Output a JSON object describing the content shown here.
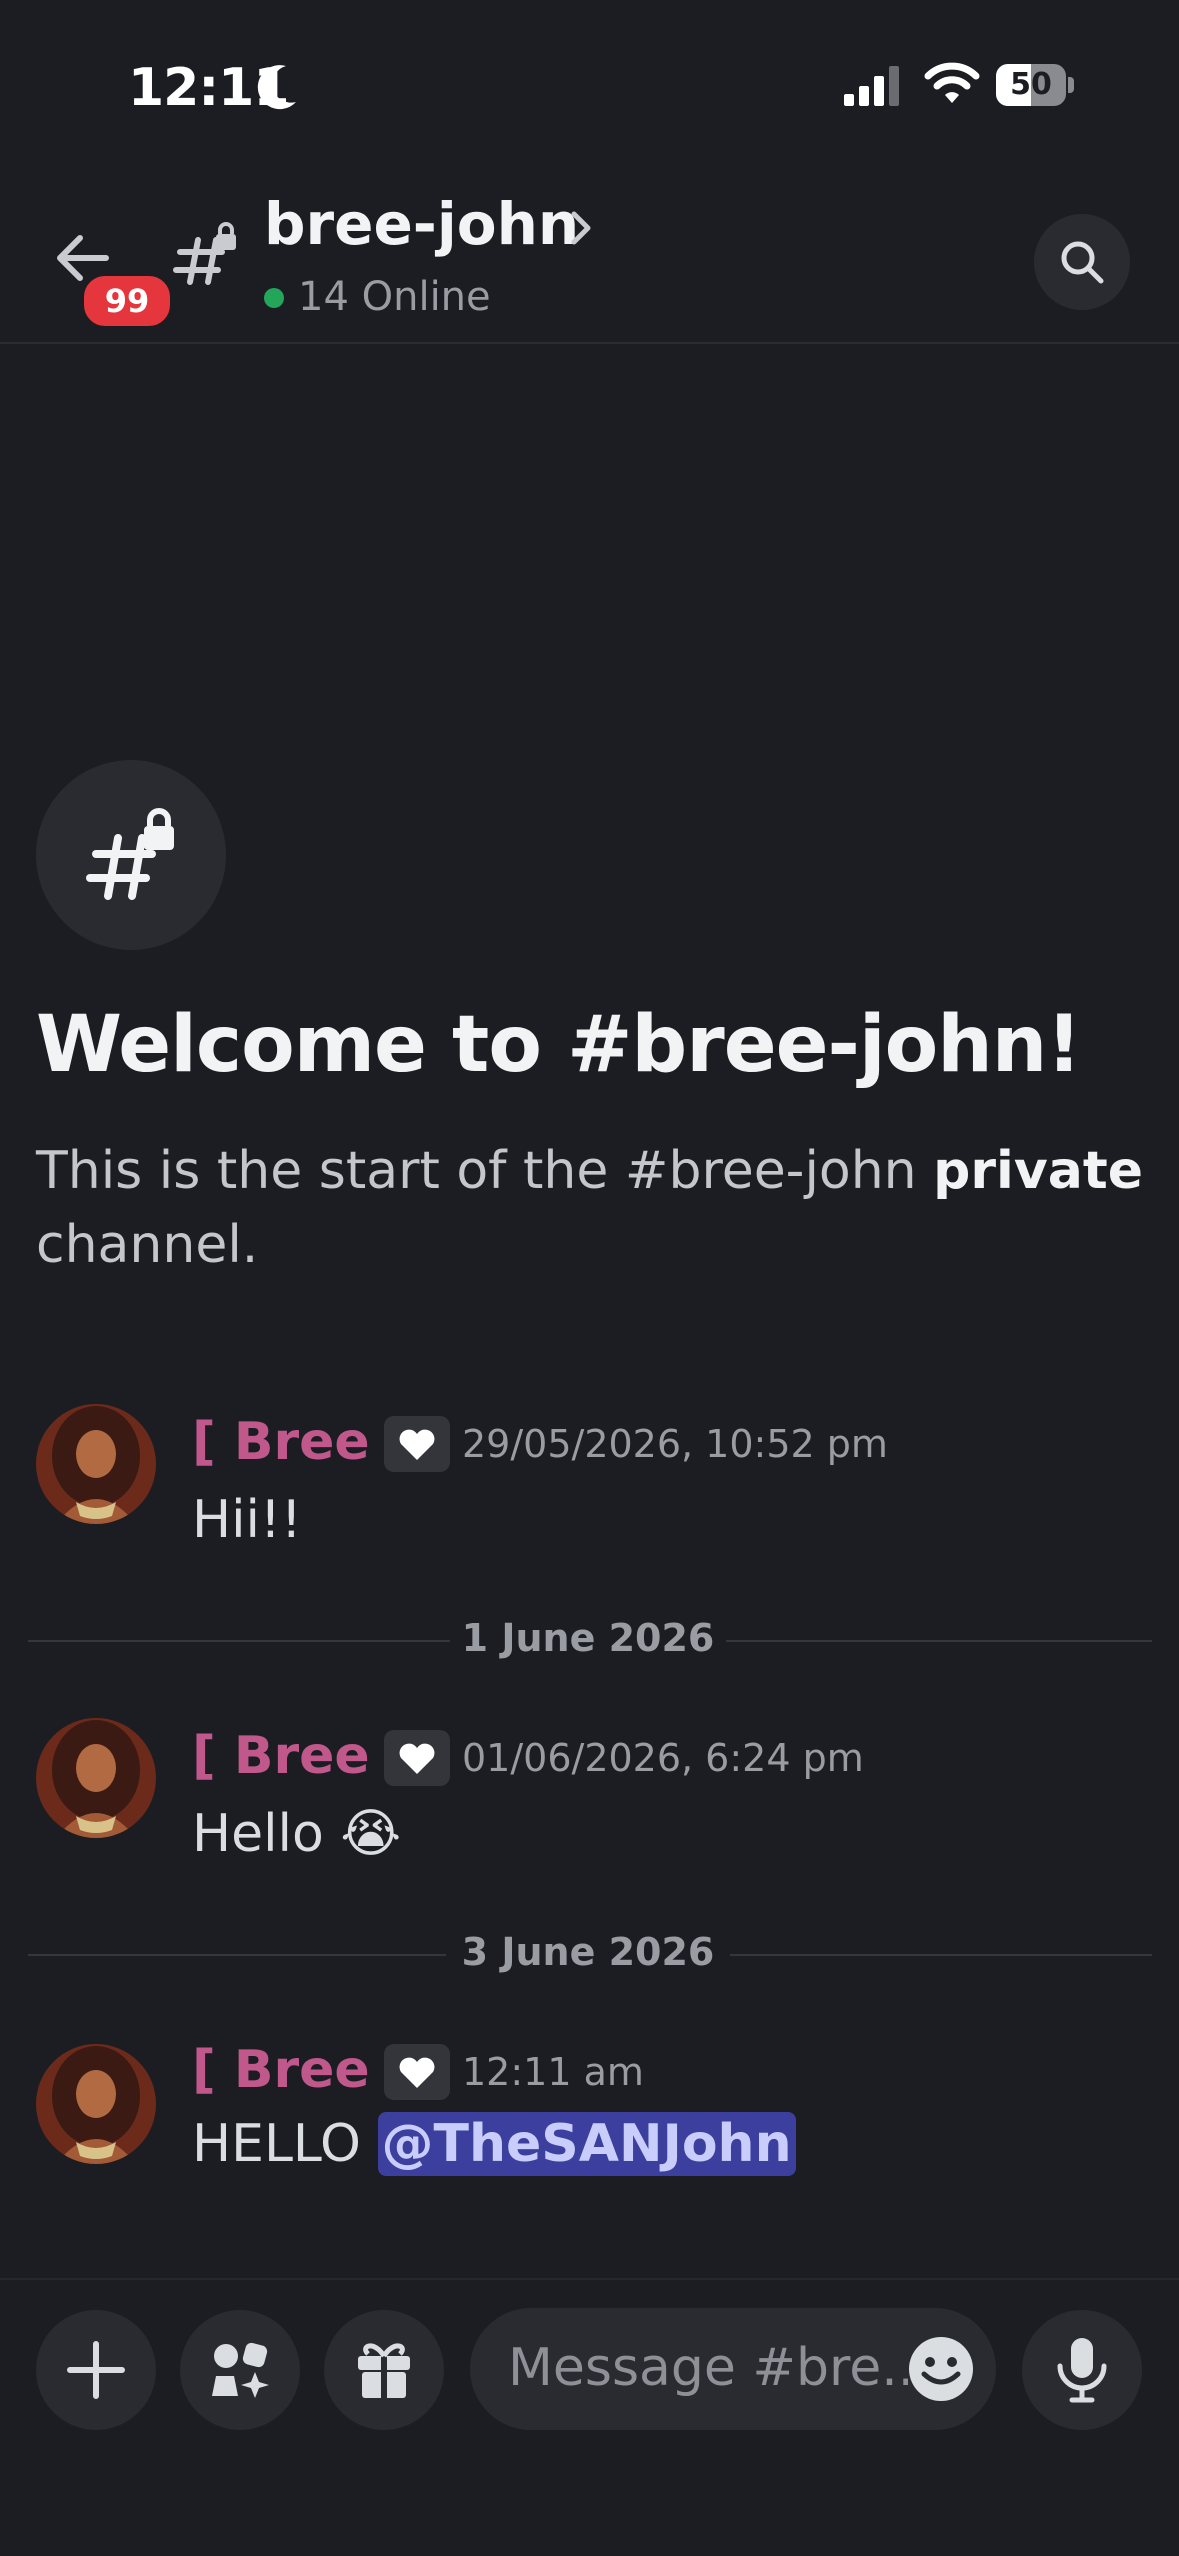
{
  "status_bar": {
    "time": "12:11",
    "battery": "50",
    "battery_level": 0.5
  },
  "header": {
    "unread_badge": "99",
    "channel_name": "bree-john",
    "online_text": "14 Online"
  },
  "welcome": {
    "title": "Welcome to #bree-john!",
    "desc_prefix": "This is the start of the #bree-john ",
    "desc_bold": "private",
    "desc_suffix": " channel."
  },
  "messages": [
    {
      "author": "[ Bree ]",
      "timestamp": "29/05/2026, 10:52 pm",
      "text": "Hii!!"
    },
    {
      "author": "[ Bree ]",
      "timestamp": "01/06/2026, 6:24 pm",
      "text": "Hello",
      "emoji": "😭"
    },
    {
      "author": "[ Bree ]",
      "timestamp": "12:11 am",
      "text": "HELLO",
      "mention": "@TheSANJohn"
    }
  ],
  "dividers": [
    "1 June 2026",
    "3 June 2026"
  ],
  "composer": {
    "placeholder": "Message #bre..."
  },
  "colors": {
    "background": "#1c1d22",
    "author": "#c0588c",
    "mention_bg": "#3c3f9e",
    "online": "#23a55a",
    "badge": "#e5353d"
  }
}
